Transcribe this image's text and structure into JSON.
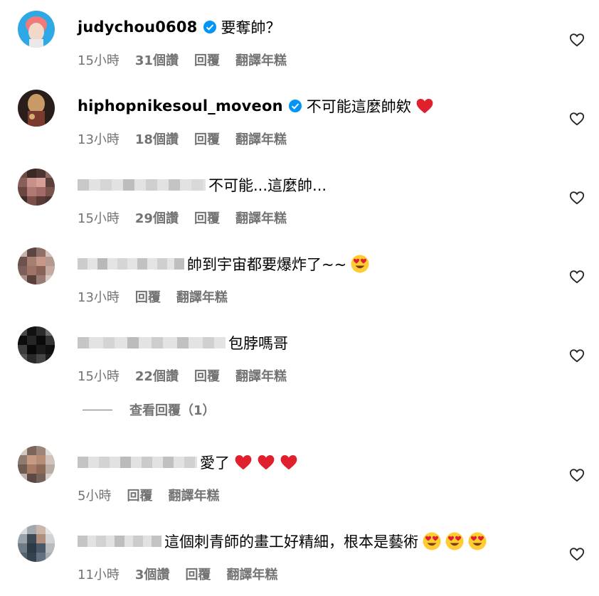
{
  "comments": [
    {
      "username": "judychou0608",
      "verified": true,
      "text": "要奪帥？",
      "time": "15小時",
      "likes": "31個讚",
      "reply": "回覆",
      "translate": "翻譯年糕"
    },
    {
      "username": "hiphopnikesoul_moveon",
      "verified": true,
      "text": "不可能這麼帥欸",
      "time": "13小時",
      "likes": "18個讚",
      "reply": "回覆",
      "translate": "翻譯年糕"
    },
    {
      "username": "",
      "verified": false,
      "text": "不可能...這麼帥...",
      "time": "15小時",
      "likes": "29個讚",
      "reply": "回覆",
      "translate": "翻譯年糕"
    },
    {
      "username": "",
      "verified": false,
      "text": "帥到宇宙都要爆炸了~~",
      "time": "13小時",
      "likes": "",
      "reply": "回覆",
      "translate": "翻譯年糕"
    },
    {
      "username": "",
      "verified": false,
      "text": "包脖嗎哥",
      "time": "15小時",
      "likes": "22個讚",
      "reply": "回覆",
      "translate": "翻譯年糕"
    },
    {
      "username": "",
      "verified": false,
      "text": "愛了",
      "time": "5小時",
      "likes": "",
      "reply": "回覆",
      "translate": "翻譯年糕"
    },
    {
      "username": "",
      "verified": false,
      "text": "這個刺青師的畫工好精細，根本是藝術",
      "time": "11小時",
      "likes": "3個讚",
      "reply": "回覆",
      "translate": "翻譯年糕"
    }
  ],
  "view_replies": {
    "label": "查看回覆（1）"
  },
  "icons": {
    "like": "heart-outline-icon",
    "verified": "verified-badge-icon",
    "heart_emoji": "red-heart-emoji",
    "heart_eyes": "heart-eyes-emoji"
  },
  "colors": {
    "verified": "#0095f6",
    "meta_text": "#737373",
    "heart_red": "#e0202c",
    "emoji_yellow": "#ffcc33"
  }
}
